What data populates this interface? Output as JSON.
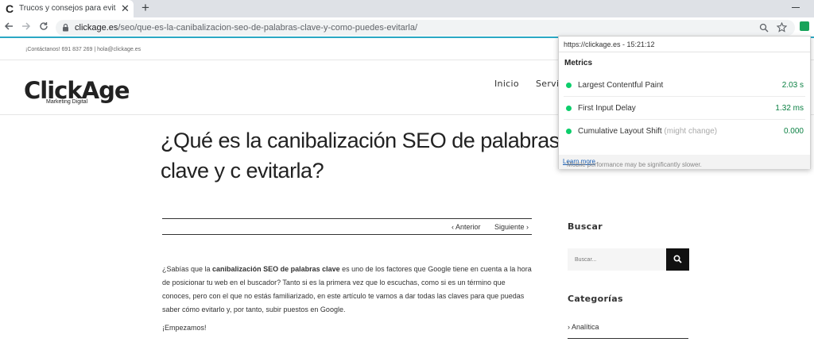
{
  "browser": {
    "tab_title": "Trucos y consejos para evitar la c",
    "favicon": "C",
    "url_domain": "clickage.es",
    "url_path": "/seo/que-es-la-canibalizacion-seo-de-palabras-clave-y-como-puedes-evitarla/",
    "new_tab": "+",
    "close": "✕"
  },
  "site": {
    "contact": "¡Contáctanos! 691 837 269  |  hola@clickage.es",
    "logo": "ClickAge",
    "logo_sub": "Marketing Digital",
    "nav": [
      "Inicio",
      "Servic"
    ]
  },
  "post": {
    "title": "¿Qué es la canibalización SEO de palabras clave y c evitarla?",
    "prev": "‹  Anterior",
    "next": "Siguiente  ›",
    "p1_before": "¿Sabías que la ",
    "p1_bold": "canibalización SEO de palabras clave",
    "p1_after": " es uno de los factores que Google tiene en cuenta a la hora de posicionar tu web en el buscador? Tanto si es la primera vez que lo escuchas, como si es un término que conoces, pero con el que no estás familiarizado, en este artículo te vamos a dar todas las claves para que puedas saber cómo evitarlo y, por tanto, subir puestos en Google.",
    "p2": "¡Empezamos!"
  },
  "sidebar": {
    "search_title": "Buscar",
    "search_placeholder": "Buscar...",
    "categories_title": "Categorías",
    "category_1": "› Analítica"
  },
  "popup": {
    "header": "https://clickage.es - 15:21:12",
    "title": "Metrics",
    "metrics": [
      {
        "name": "Largest Contentful Paint",
        "note": "",
        "value": "2.03 s"
      },
      {
        "name": "First Input Delay",
        "note": "",
        "value": "1.32 ms"
      },
      {
        "name": "Cumulative Layout Shift",
        "note": "(might change)",
        "value": "0.000"
      }
    ],
    "footer_text": "Mobile performance may be significantly slower.",
    "footer_link": "Learn more"
  },
  "colors": {
    "accent": "#2aa8c4",
    "good": "#0cce6b",
    "extension": "#18a35a"
  },
  "icons": [
    "back-arrow-icon",
    "forward-arrow-icon",
    "reload-icon",
    "lock-icon",
    "zoom-icon",
    "star-icon",
    "search-icon"
  ]
}
